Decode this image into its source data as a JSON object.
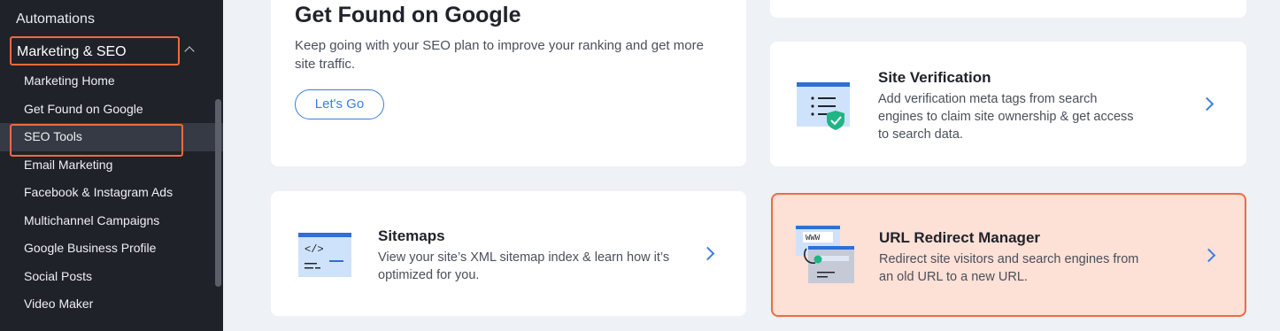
{
  "sidebar": {
    "automations": "Automations",
    "group_label": "Marketing & SEO",
    "items": [
      {
        "label": "Marketing Home"
      },
      {
        "label": "Get Found on Google"
      },
      {
        "label": "SEO Tools"
      },
      {
        "label": "Email Marketing"
      },
      {
        "label": "Facebook & Instagram Ads"
      },
      {
        "label": "Multichannel Campaigns"
      },
      {
        "label": "Google Business Profile"
      },
      {
        "label": "Social Posts"
      },
      {
        "label": "Video Maker"
      }
    ],
    "active_item": "SEO Tools"
  },
  "get_found": {
    "title": "Get Found on Google",
    "description": "Keep going with your SEO plan to improve your ranking and get more site traffic.",
    "button_label": "Let's Go"
  },
  "site_verification": {
    "title": "Site Verification",
    "description": "Add verification meta tags from search engines to claim site ownership & get access to search data."
  },
  "sitemaps": {
    "title": "Sitemaps",
    "description": "View your site’s XML sitemap index & learn how it’s optimized for you.",
    "illus_text": "</>"
  },
  "url_redirect": {
    "title": "URL Redirect Manager",
    "description": "Redirect site visitors and search engines from an old URL to a new URL.",
    "illus_text": "WWW"
  },
  "colors": {
    "sidebar_bg": "#1f2229",
    "highlight": "#f26a3d",
    "accent_blue": "#3b7de0",
    "page_bg": "#eef1f6"
  }
}
